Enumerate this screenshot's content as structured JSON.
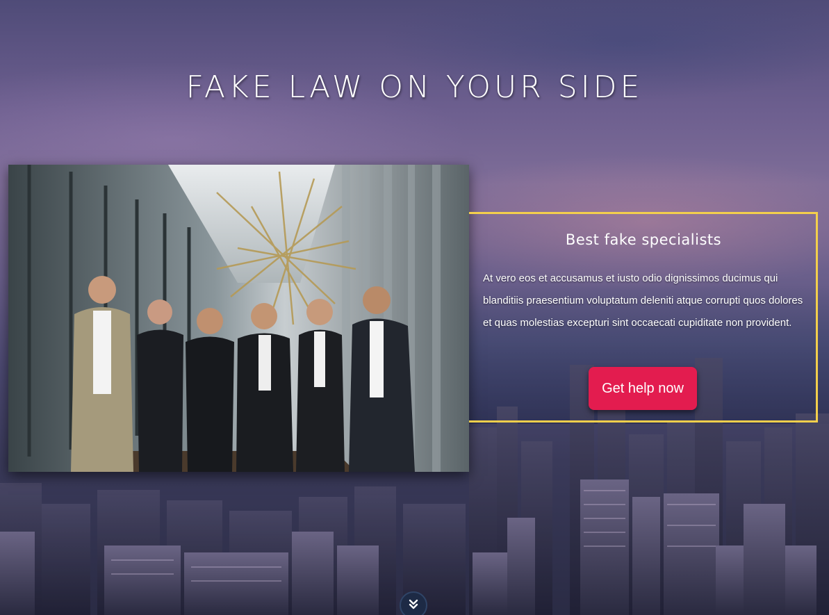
{
  "hero": {
    "headline": "FAKE LAW ON YOUR SIDE",
    "photo_alt": "Team of six professionals in business attire standing in an office",
    "card": {
      "title": "Best fake specialists",
      "body": "At vero eos et accusamus et iusto odio dignissimos ducimus qui blanditiis praesentium voluptatum deleniti atque corrupti quos dolores et quas molestias excepturi sint occaecati cupiditate non provident.",
      "cta_label": "Get help now"
    },
    "scroll_icon": "double-chevron-down-icon"
  },
  "colors": {
    "accent_border": "#f3cf4c",
    "cta_background": "#e31c4f",
    "text": "#ffffff"
  }
}
